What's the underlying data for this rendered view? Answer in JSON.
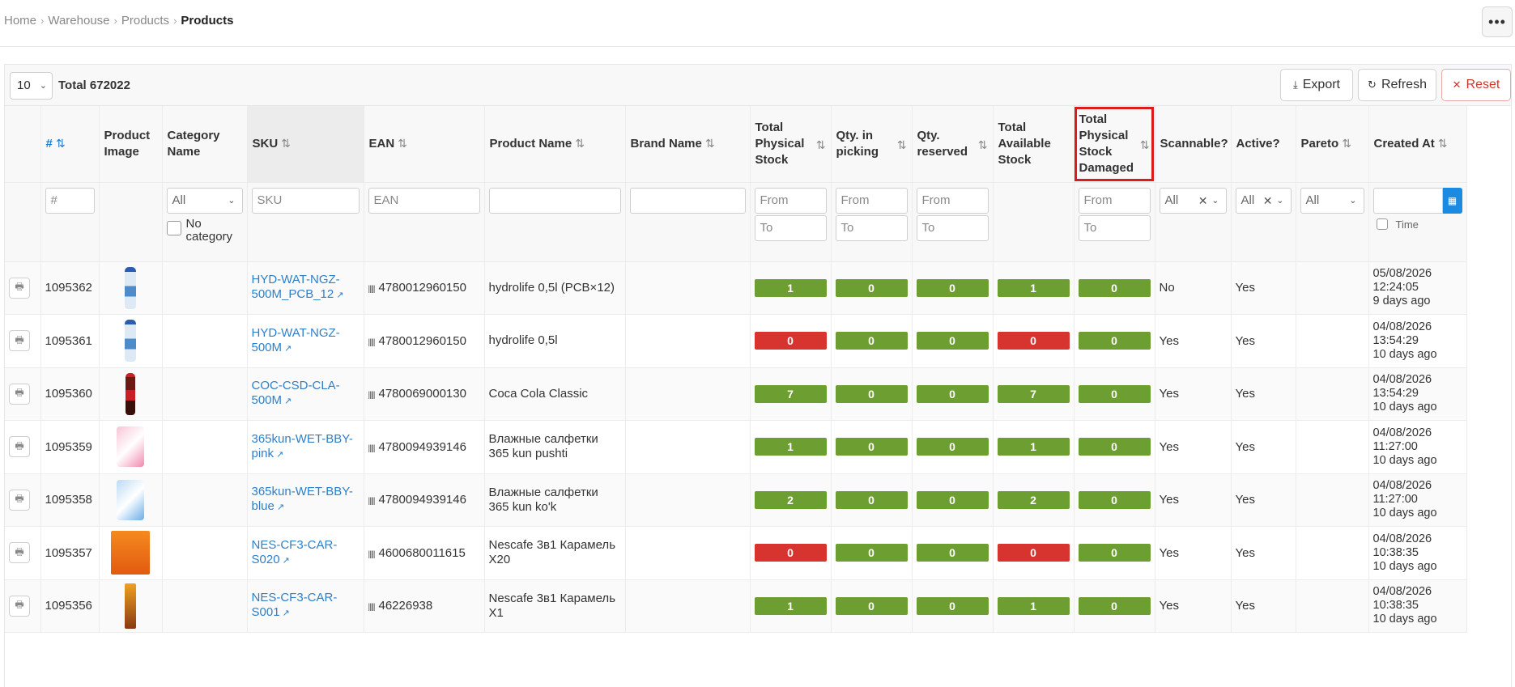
{
  "breadcrumb": {
    "items": [
      "Home",
      "Warehouse",
      "Products"
    ],
    "current": "Products"
  },
  "toolbar": {
    "page_size": "10",
    "total": "Total 672022",
    "export_label": "Export",
    "refresh_label": "Refresh",
    "reset_label": "Reset"
  },
  "columns": {
    "id": "#",
    "image": "Product Image",
    "category": "Category Name",
    "sku": "SKU",
    "ean": "EAN",
    "product_name": "Product Name",
    "brand": "Brand Name",
    "total_physical": "Total Physical Stock",
    "qty_picking": "Qty. in picking",
    "qty_reserved": "Qty. reserved",
    "total_available": "Total Available Stock",
    "total_damaged": "Total Physical Stock Damaged",
    "scannable": "Scannable?",
    "active": "Active?",
    "pareto": "Pareto",
    "created_at": "Created At"
  },
  "filters": {
    "id_placeholder": "#",
    "category_value": "All",
    "no_category_label": "No category",
    "sku_placeholder": "SKU",
    "ean_placeholder": "EAN",
    "from_placeholder": "From",
    "to_placeholder": "To",
    "scannable_value": "All",
    "active_value": "All",
    "pareto_value": "All",
    "time_label": "Time"
  },
  "icons": {
    "sort": "sort-icon",
    "sort_active": "sort-asc-icon",
    "print": "printer-icon",
    "external": "external-link-icon",
    "barcode": "barcode-icon",
    "calendar": "calendar-icon",
    "export": "download-icon",
    "refresh": "refresh-icon",
    "reset": "close-icon",
    "more": "more-horizontal-icon"
  },
  "colors": {
    "ok": "#6d9e32",
    "alert": "#d7332f",
    "link": "#2f7fc8",
    "highlight": "#d91c1c"
  },
  "rows": [
    {
      "id": "1095362",
      "image": "water-bottle",
      "sku_l1": "HYD-WAT-NGZ-",
      "sku_l2": "500M_PCB_12",
      "ean": "4780012960150",
      "name_l1": "hydrolife 0,5l (PCB×12)",
      "name_l2": "",
      "phys": "1",
      "pick": "0",
      "res": "0",
      "avail": "1",
      "dmg": "0",
      "phys_alert": false,
      "avail_alert": false,
      "scannable": "No",
      "active": "Yes",
      "date": "05/08/2026",
      "time": "12:24:05",
      "ago": "9 days ago"
    },
    {
      "id": "1095361",
      "image": "water-bottle",
      "sku_l1": "HYD-WAT-NGZ-",
      "sku_l2": "500M",
      "ean": "4780012960150",
      "name_l1": "hydrolife 0,5l",
      "name_l2": "",
      "phys": "0",
      "pick": "0",
      "res": "0",
      "avail": "0",
      "dmg": "0",
      "phys_alert": true,
      "avail_alert": true,
      "scannable": "Yes",
      "active": "Yes",
      "date": "04/08/2026",
      "time": "13:54:29",
      "ago": "10 days ago"
    },
    {
      "id": "1095360",
      "image": "cola-bottle",
      "sku_l1": "COC-CSD-CLA-",
      "sku_l2": "500M",
      "ean": "4780069000130",
      "name_l1": "Coca Cola Classic",
      "name_l2": "",
      "phys": "7",
      "pick": "0",
      "res": "0",
      "avail": "7",
      "dmg": "0",
      "phys_alert": false,
      "avail_alert": false,
      "scannable": "Yes",
      "active": "Yes",
      "date": "04/08/2026",
      "time": "13:54:29",
      "ago": "10 days ago"
    },
    {
      "id": "1095359",
      "image": "wipes-pink",
      "sku_l1": "365kun-WET-BBY-",
      "sku_l2": "pink",
      "ean": "4780094939146",
      "name_l1": "Влажные салфетки",
      "name_l2": "365 kun pushti",
      "phys": "1",
      "pick": "0",
      "res": "0",
      "avail": "1",
      "dmg": "0",
      "phys_alert": false,
      "avail_alert": false,
      "scannable": "Yes",
      "active": "Yes",
      "date": "04/08/2026",
      "time": "11:27:00",
      "ago": "10 days ago"
    },
    {
      "id": "1095358",
      "image": "wipes-blue",
      "sku_l1": "365kun-WET-BBY-",
      "sku_l2": "blue",
      "ean": "4780094939146",
      "name_l1": "Влажные салфетки",
      "name_l2": "365 kun ko'k",
      "phys": "2",
      "pick": "0",
      "res": "0",
      "avail": "2",
      "dmg": "0",
      "phys_alert": false,
      "avail_alert": false,
      "scannable": "Yes",
      "active": "Yes",
      "date": "04/08/2026",
      "time": "11:27:00",
      "ago": "10 days ago"
    },
    {
      "id": "1095357",
      "image": "coffee-box",
      "sku_l1": "NES-CF3-CAR-",
      "sku_l2": "S020",
      "ean": "4600680011615",
      "name_l1": "Nescafe 3в1 Карамель",
      "name_l2": "X20",
      "phys": "0",
      "pick": "0",
      "res": "0",
      "avail": "0",
      "dmg": "0",
      "phys_alert": true,
      "avail_alert": true,
      "scannable": "Yes",
      "active": "Yes",
      "date": "04/08/2026",
      "time": "10:38:35",
      "ago": "10 days ago"
    },
    {
      "id": "1095356",
      "image": "coffee-stick",
      "sku_l1": "NES-CF3-CAR-",
      "sku_l2": "S001",
      "ean": "46226938",
      "name_l1": "Nescafe 3в1 Карамель",
      "name_l2": "X1",
      "phys": "1",
      "pick": "0",
      "res": "0",
      "avail": "1",
      "dmg": "0",
      "phys_alert": false,
      "avail_alert": false,
      "scannable": "Yes",
      "active": "Yes",
      "date": "04/08/2026",
      "time": "10:38:35",
      "ago": "10 days ago"
    }
  ]
}
